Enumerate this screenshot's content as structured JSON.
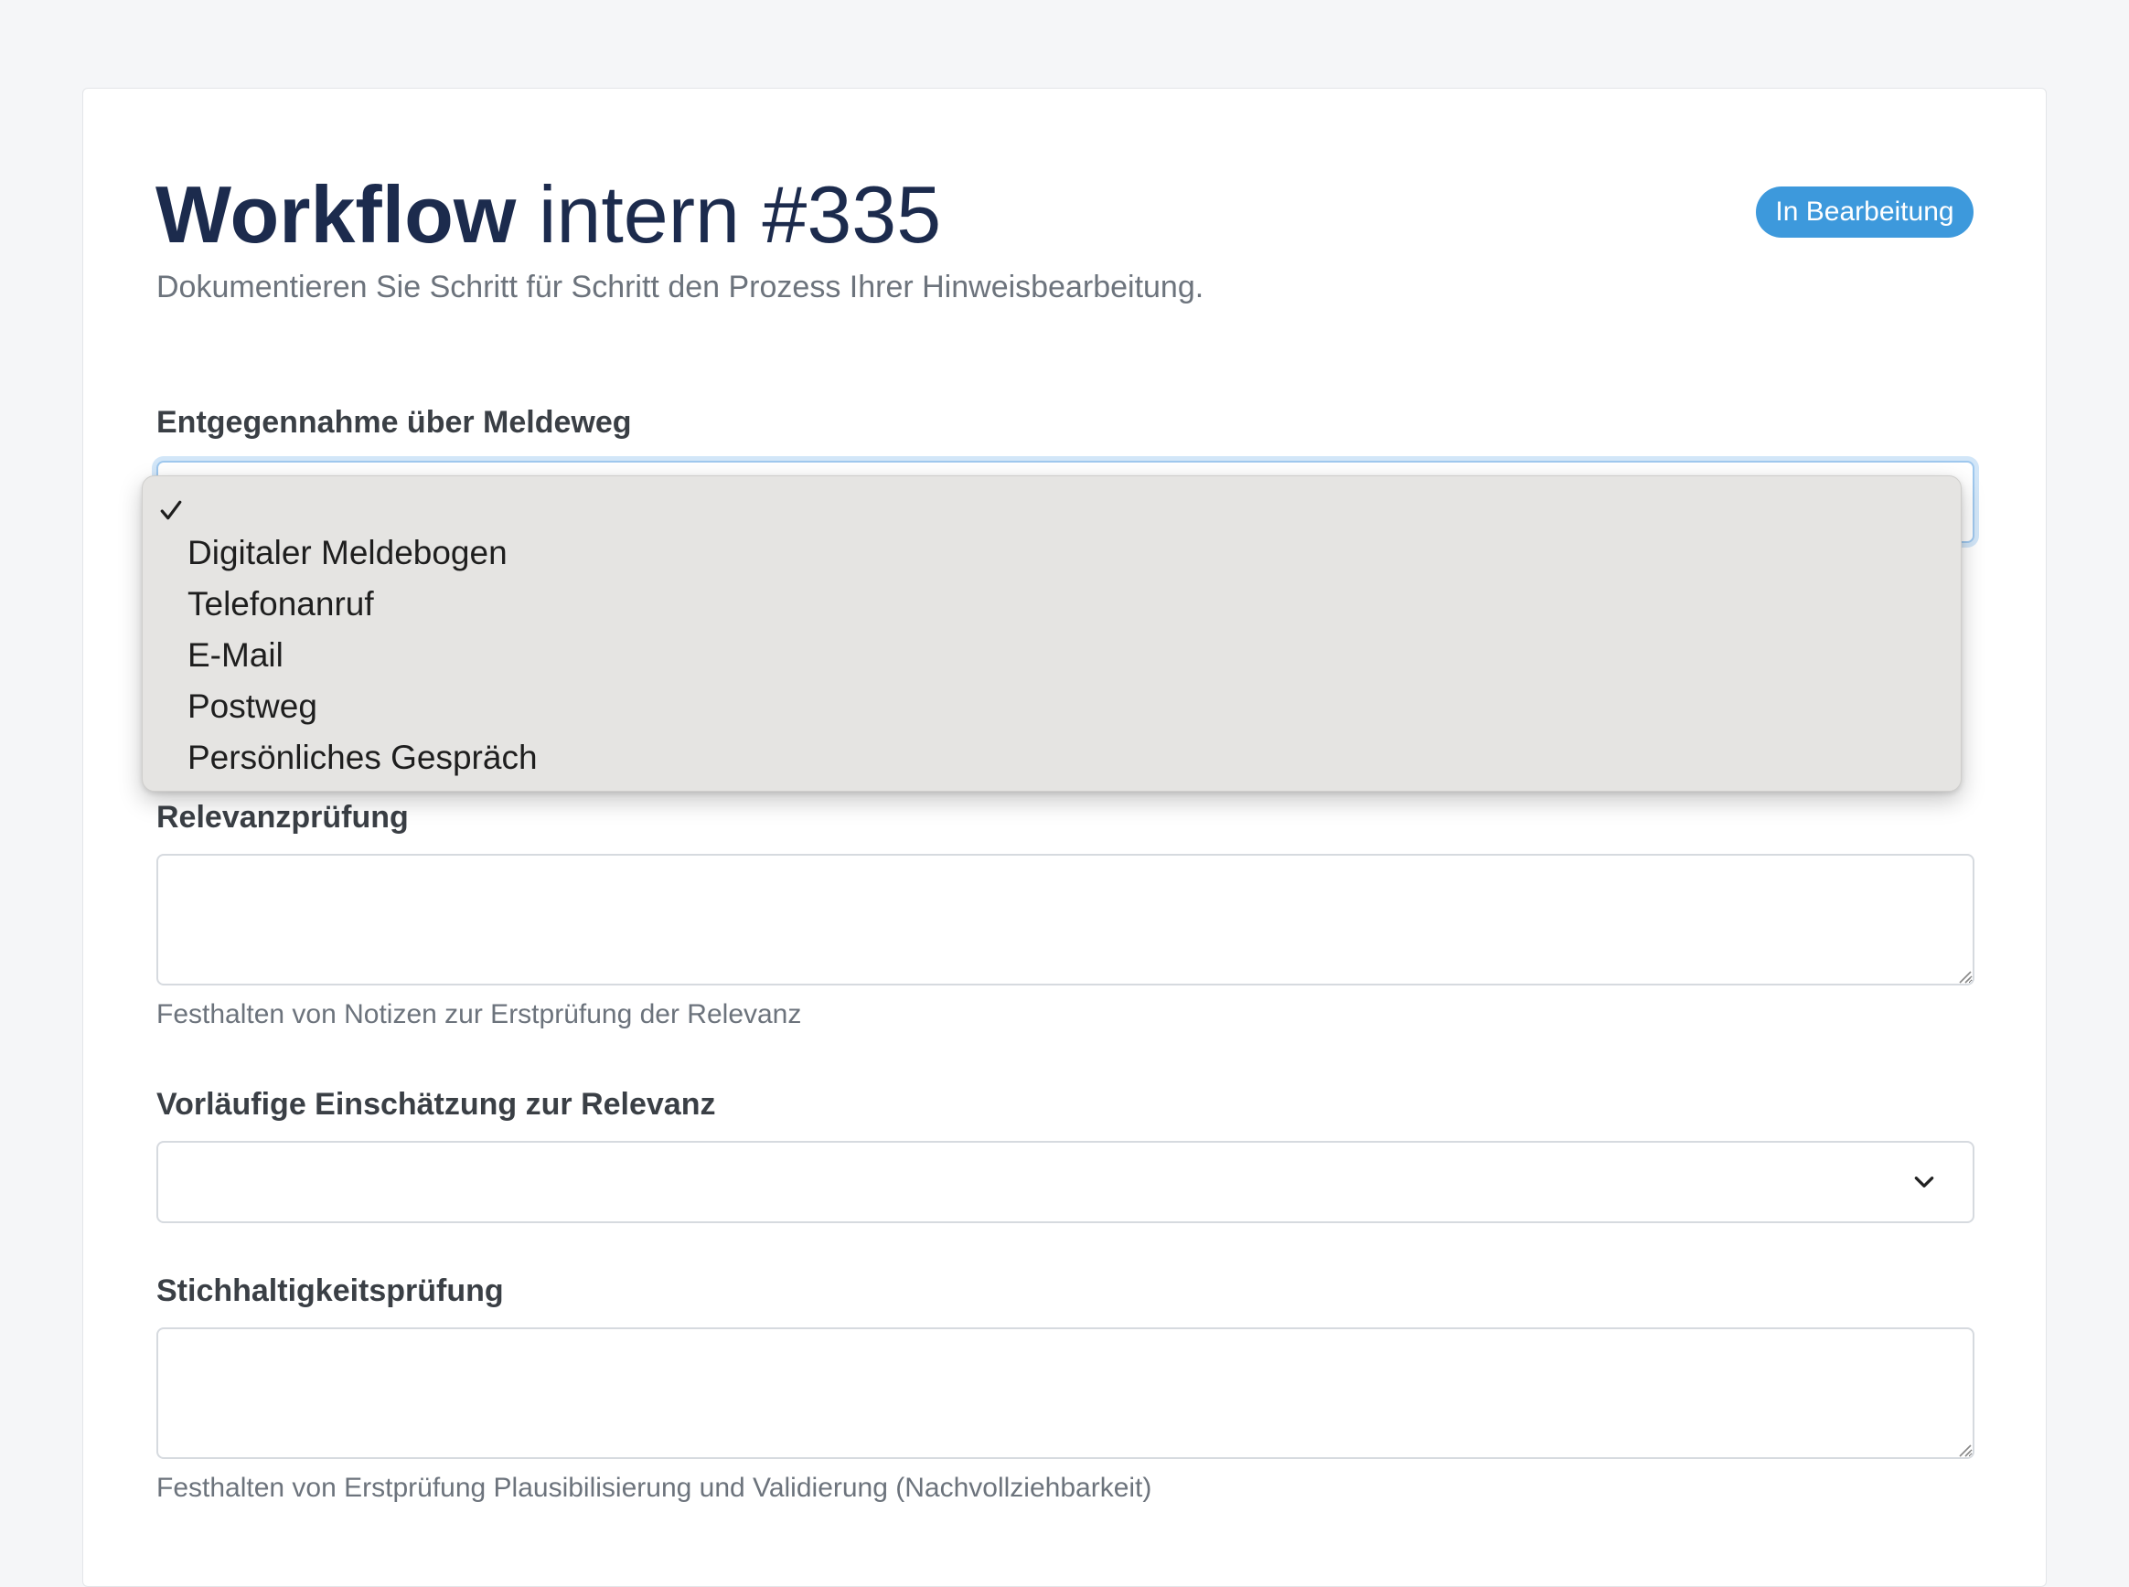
{
  "workflow": {
    "title_bold": "Workflow",
    "title_rest": " intern #335",
    "subtitle": "Dokumentieren Sie Schritt für Schritt den Prozess Ihrer Hinweisbearbeitung.",
    "status_badge": "In Bearbeitung",
    "status_color": "#3d99dc"
  },
  "fields": {
    "meldeweg": {
      "label": "Entgegennahme über Meldeweg",
      "value": "",
      "options": [
        "",
        "Digitaler Meldebogen",
        "Telefonanruf",
        "E-Mail",
        "Postweg",
        "Persönliches Gespräch"
      ],
      "selected_index": 0
    },
    "relevanzpruefung": {
      "label": "Relevanzprüfung",
      "value": "",
      "help": "Festhalten von Notizen zur Erstprüfung der Relevanz"
    },
    "einschaetzung": {
      "label": "Vorläufige Einschätzung zur Relevanz",
      "value": ""
    },
    "stichhaltigkeit": {
      "label": "Stichhaltigkeitsprüfung",
      "value": "",
      "help": "Festhalten von Erstprüfung Plausibilisierung und Validierung (Nachvollziehbarkeit)"
    }
  },
  "icons": {
    "select_arrow": "chevron-down-icon",
    "selected_marker": "checkmark-icon",
    "textarea_handle": "resize-grip-icon"
  }
}
